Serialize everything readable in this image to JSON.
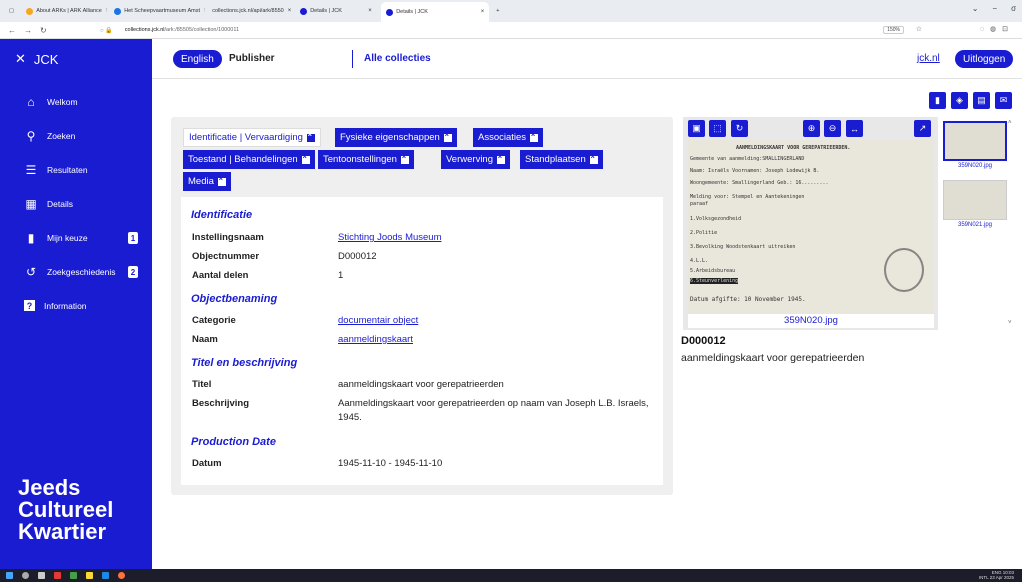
{
  "browser": {
    "tabs": [
      {
        "label": "About ARKs | ARK Alliance",
        "color": "#f5a623"
      },
      {
        "label": "Het Scheepvaartmuseum Amst",
        "color": "#1a73e8"
      },
      {
        "label": "collections.jck.nl/api/ark/8550",
        "color": "#999999"
      },
      {
        "label": "Details | JCK",
        "color": "#1a1cd1"
      },
      {
        "label": "Details | JCK",
        "color": "#1a1cd1"
      }
    ],
    "url_domain": "collections.jck.nl",
    "url_path": "/ark:/85505/collection/1000011",
    "zoom": "150%"
  },
  "header": {
    "brand": "JCK",
    "lang_english": "English",
    "publisher": "Publisher",
    "alle_collecties": "Alle collecties",
    "jck_link": "jck.nl",
    "logout": "Uitloggen"
  },
  "sidebar": {
    "items": [
      {
        "label": "Welkom",
        "icon": "home-icon"
      },
      {
        "label": "Zoeken",
        "icon": "search-icon"
      },
      {
        "label": "Resultaten",
        "icon": "list-icon"
      },
      {
        "label": "Details",
        "icon": "grid-icon"
      },
      {
        "label": "Mijn keuze",
        "icon": "bookmark-icon",
        "badge": "1"
      },
      {
        "label": "Zoekgeschiedenis",
        "icon": "history-icon",
        "badge": "2"
      },
      {
        "label": "Information",
        "icon": "question-icon"
      }
    ],
    "logo_line1": "Jeeds",
    "logo_line2": "Cultureel",
    "logo_line3": "Kwartier"
  },
  "tabs": {
    "t1": "Identificatie | Vervaardiging",
    "t2": "Fysieke eigenschappen",
    "t3": "Associaties",
    "t4": "Toestand | Behandelingen",
    "t5": "Tentoonstellingen",
    "t6": "Verwerving",
    "t7": "Standplaatsen",
    "t8": "Media"
  },
  "details": {
    "sec_identificatie": "Identificatie",
    "instellingsnaam_label": "Instellingsnaam",
    "instellingsnaam_value": "Stichting Joods Museum",
    "objectnummer_label": "Objectnummer",
    "objectnummer_value": "D000012",
    "aantal_label": "Aantal delen",
    "aantal_value": "1",
    "sec_objectbenaming": "Objectbenaming",
    "categorie_label": "Categorie",
    "categorie_value": "documentair object",
    "naam_label": "Naam",
    "naam_value": "aanmeldingskaart",
    "sec_titel": "Titel en beschrijving",
    "titel_label": "Titel",
    "titel_value": "aanmeldingskaart voor gerepatrieerden",
    "beschrijving_label": "Beschrijving",
    "beschrijving_value": "Aanmeldingskaart voor gerepatrieerden op naam van Joseph L.B. Israels, 1945.",
    "sec_production": "Production Date",
    "datum_label": "Datum",
    "datum_value": "1945-11-10 - 1945-11-10"
  },
  "viewer": {
    "caption": "359N020.jpg",
    "thumb1": "359N020.jpg",
    "thumb2": "359N021.jpg",
    "doc_lines": [
      "AANMELDINGSKAART VOOR GEREPATRIEERDEN.",
      "Gemeente van aanmelding:SMALLINGERLAND",
      "Naam: Israëls          Voornamen: Joseph Lodewijk B.",
      "Woongemeente: Smallingerland      Geb.: 16.........",
      "Melding voor:      Stempel en        Aantekeningen",
      "                   paraaf",
      "1.Volksgezondheid",
      "2.Politie",
      "3.Bevolking Woodstenkaart uitreiken",
      "4.L.L.",
      "5.Arbeidsbureau",
      "6.Steunverlening",
      "Datum afgifte: 10 November 1945."
    ],
    "object_number": "D000012",
    "object_title": "aanmeldingskaart voor gerepatrieerden"
  },
  "taskbar": {
    "lang": "ENG",
    "lang2": "INTL",
    "time": "10:03",
    "date": "23 Apr 2025"
  }
}
